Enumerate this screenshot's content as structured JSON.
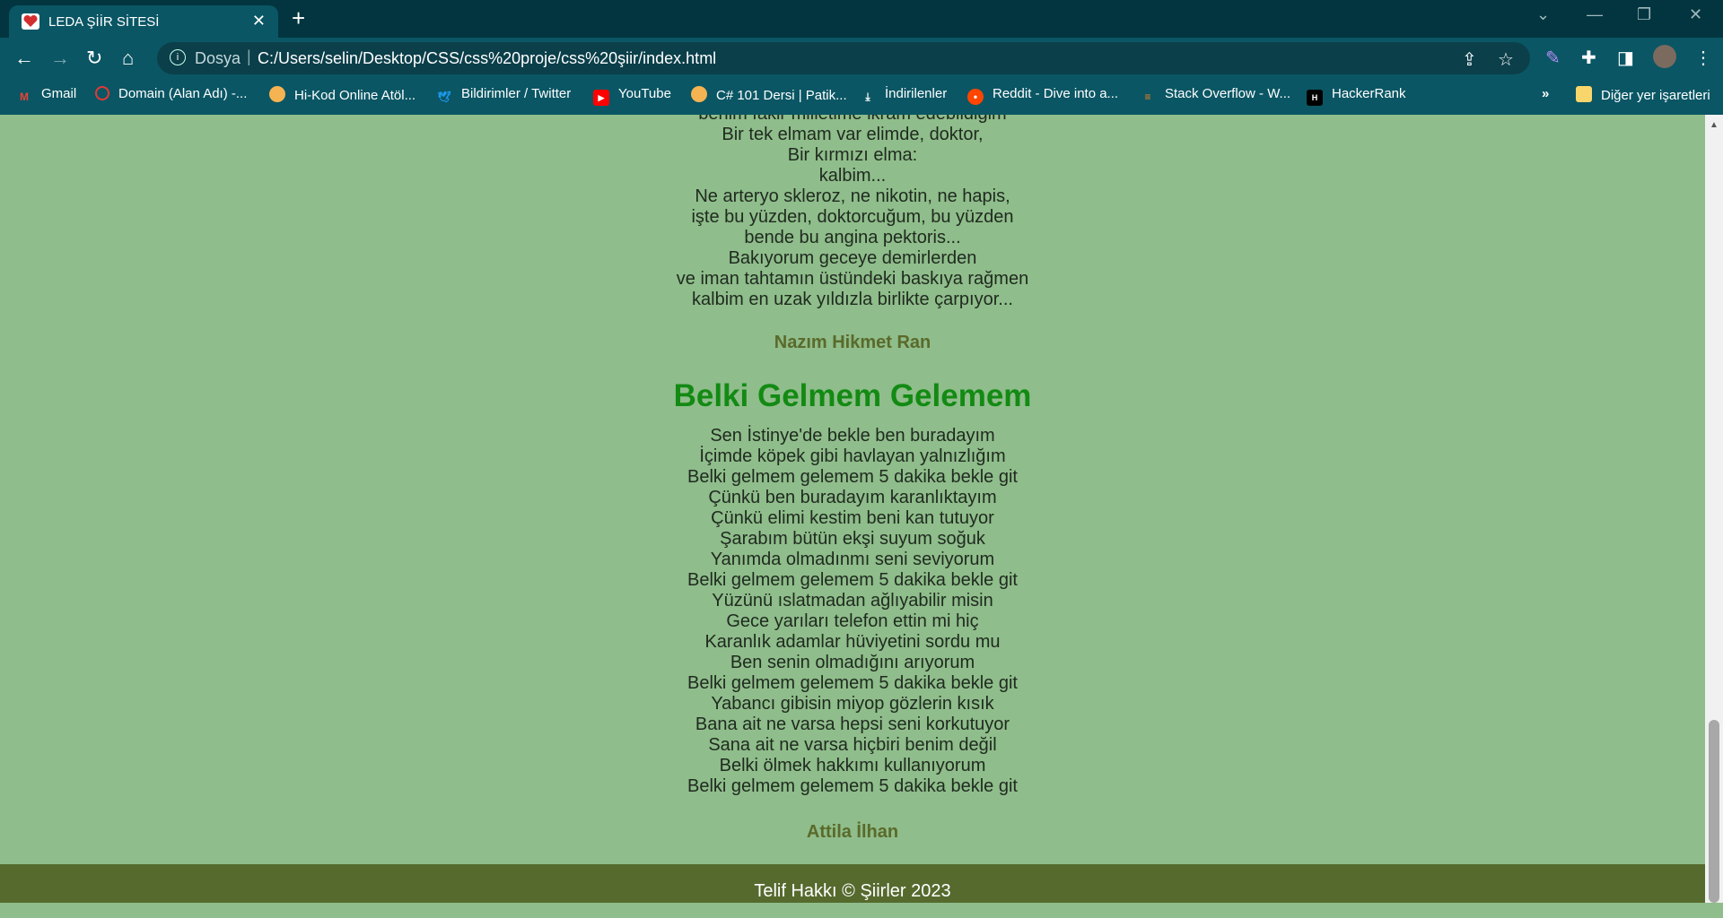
{
  "browser": {
    "tab_title": "LEDA ŞİİR SİTESİ",
    "url_scheme": "Dosya",
    "url": "C:/Users/selin/Desktop/CSS/css%20proje/css%20şiir/index.html"
  },
  "bookmarks": [
    {
      "label": "Gmail",
      "icon": "gmail-icon",
      "color": "#ea4335"
    },
    {
      "label": "Domain (Alan Adı) -...",
      "icon": "domain-icon",
      "color": "#e53935"
    },
    {
      "label": "Hi-Kod Online Atöl...",
      "icon": "hikod-icon",
      "color": "#f6b352"
    },
    {
      "label": "Bildirimler / Twitter",
      "icon": "twitter-icon",
      "color": "#1d9bf0"
    },
    {
      "label": "YouTube",
      "icon": "youtube-icon",
      "color": "#ff0000"
    },
    {
      "label": "C# 101 Dersi | Patik...",
      "icon": "patika-icon",
      "color": "#f6b352"
    },
    {
      "label": "İndirilenler",
      "icon": "download-icon",
      "color": "#ffffff"
    },
    {
      "label": "Reddit - Dive into a...",
      "icon": "reddit-icon",
      "color": "#ff4500"
    },
    {
      "label": "Stack Overflow - W...",
      "icon": "stackoverflow-icon",
      "color": "#f48024"
    },
    {
      "label": "HackerRank",
      "icon": "hackerrank-icon",
      "color": "#000000"
    }
  ],
  "bookmarks_more": "»",
  "other_bookmarks": "Diğer yer işaretleri",
  "poem1": {
    "lines": [
      "benim fakir milletime ikram edebildiğim",
      "Bir tek elmam var elimde, doktor,",
      "Bir kırmızı elma:",
      "kalbim...",
      "Ne arteryo skleroz, ne nikotin, ne hapis,",
      "işte bu yüzden, doktorcuğum, bu yüzden",
      "bende bu angina pektoris...",
      "Bakıyorum geceye demirlerden",
      "ve iman tahtamın üstündeki baskıya rağmen",
      "kalbim en uzak yıldızla birlikte çarpıyor..."
    ],
    "author": "Nazım Hikmet Ran"
  },
  "poem2": {
    "title": "Belki Gelmem Gelemem",
    "lines": [
      "Sen İstinye'de bekle ben buradayım",
      "İçimde köpek gibi havlayan yalnızlığım",
      "Belki gelmem gelemem 5 dakika bekle git",
      "Çünkü ben buradayım karanlıktayım",
      "Çünkü elimi kestim beni kan tutuyor",
      "Şarabım bütün ekşi suyum soğuk",
      "Yanımda olmadınmı seni seviyorum",
      "Belki gelmem gelemem 5 dakika bekle git",
      "Yüzünü ıslatmadan ağlıyabilir misin",
      "Gece yarıları telefon ettin mi hiç",
      "Karanlık adamlar hüviyetini sordu mu",
      "Ben senin olmadığını arıyorum",
      "Belki gelmem gelemem 5 dakika bekle git",
      "Yabancı gibisin miyop gözlerin kısık",
      "Bana ait ne varsa hepsi seni korkutuyor",
      "Sana ait ne varsa hiçbiri benim değil",
      "Belki ölmek hakkımı kullanıyorum",
      "Belki gelmem gelemem 5 dakika bekle git"
    ],
    "author": "Attila İlhan"
  },
  "footer": "Telif Hakkı © Şiirler 2023"
}
